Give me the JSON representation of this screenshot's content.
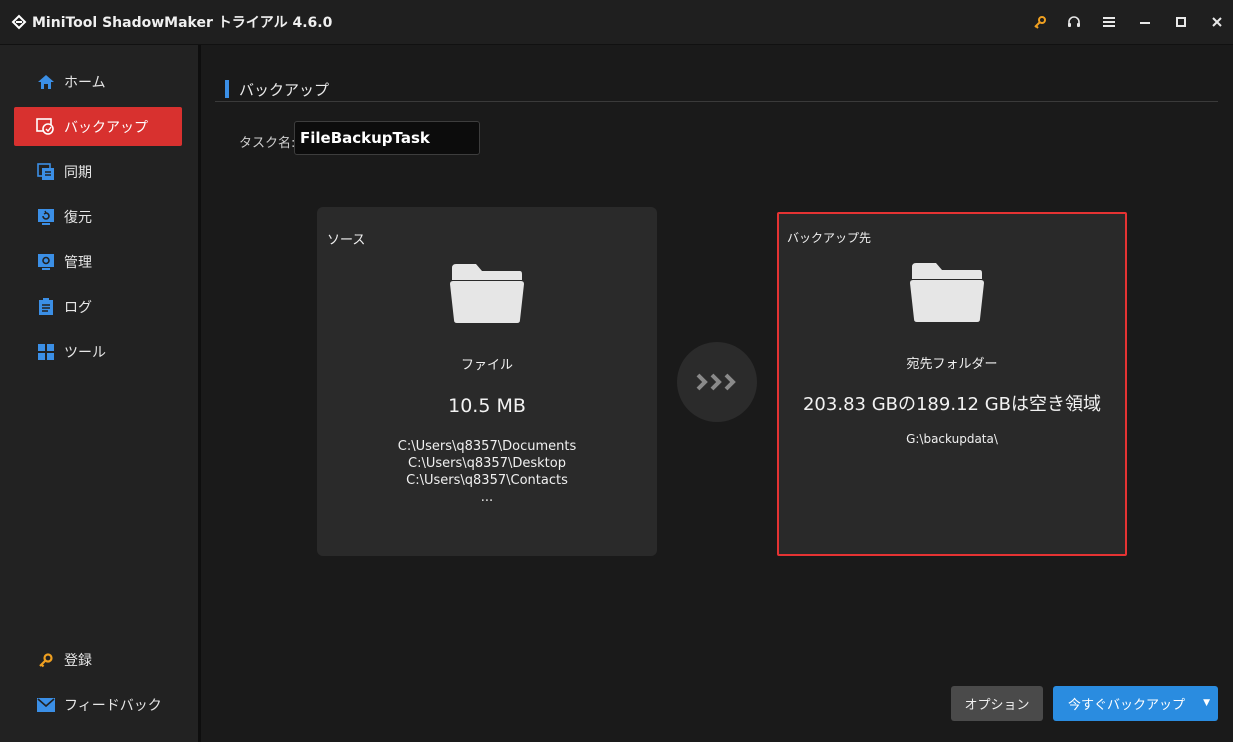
{
  "window": {
    "title": "MiniTool ShadowMaker トライアル 4.6.0"
  },
  "sidebar": {
    "items": [
      {
        "label": "ホーム",
        "icon": "home-icon"
      },
      {
        "label": "バックアップ",
        "icon": "backup-icon",
        "active": true
      },
      {
        "label": "同期",
        "icon": "sync-icon"
      },
      {
        "label": "復元",
        "icon": "restore-icon"
      },
      {
        "label": "管理",
        "icon": "manage-icon"
      },
      {
        "label": "ログ",
        "icon": "log-icon"
      },
      {
        "label": "ツール",
        "icon": "tools-icon"
      }
    ],
    "bottom": [
      {
        "label": "登録",
        "icon": "key-icon"
      },
      {
        "label": "フィードバック",
        "icon": "mail-icon"
      }
    ]
  },
  "main": {
    "section_title": "バックアップ",
    "task_label": "タスク名:",
    "task_value": "FileBackupTask",
    "source": {
      "title": "ソース",
      "type": "ファイル",
      "size": "10.5 MB",
      "paths": [
        "C:\\Users\\q8357\\Documents",
        "C:\\Users\\q8357\\Desktop",
        "C:\\Users\\q8357\\Contacts",
        "..."
      ]
    },
    "destination": {
      "title": "バックアップ先",
      "type": "宛先フォルダー",
      "space": "203.83 GBの189.12 GBは空き領域",
      "path": "G:\\backupdata\\"
    },
    "options_label": "オプション",
    "backup_now_label": "今すぐバックアップ",
    "backup_dropdown": "▼"
  },
  "colors": {
    "accent_red": "#d8312f",
    "accent_blue": "#2a8ce0",
    "highlight_border": "#e53333"
  }
}
